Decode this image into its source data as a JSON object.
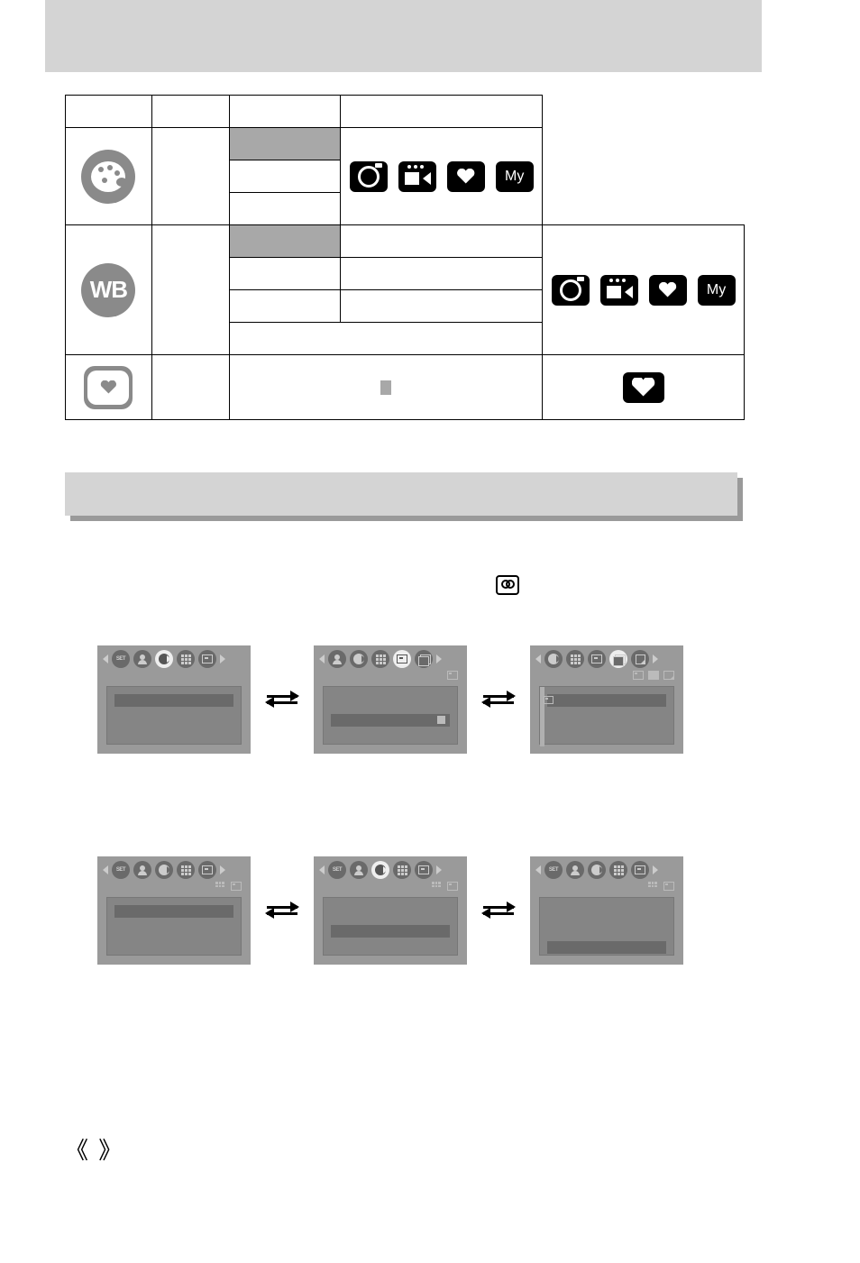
{
  "table": {
    "headers": [
      "",
      "",
      "",
      ""
    ],
    "rows": [
      {
        "icon": "palette",
        "col2": "",
        "col3": [
          "",
          "",
          ""
        ],
        "modes": [
          "camera",
          "video",
          "heart",
          "my"
        ]
      },
      {
        "icon": "wb",
        "col2": "",
        "col3_split": [
          [
            "",
            ""
          ],
          [
            "",
            ""
          ],
          [
            "",
            ""
          ]
        ],
        "col3_full": "",
        "modes": [
          "camera",
          "video",
          "heart",
          "my"
        ]
      },
      {
        "icon": "heart-frame",
        "col2": "",
        "col3_center_marker": "▮",
        "modes": [
          "heart"
        ]
      }
    ]
  },
  "icon_labels": {
    "palette": "palette-icon",
    "wb_text": "WB",
    "my_text": "My"
  },
  "section": {
    "title": ""
  },
  "inline_icon_line": "",
  "menu_screens": {
    "description": "Two rows of three camera-menu LCD mockups connected by bidirectional arrows",
    "tab_icons": [
      "set",
      "person",
      "left-arc",
      "grid",
      "frame",
      "stack",
      "corner"
    ],
    "row1": [
      {
        "active_tab_index": 2,
        "sub_icons": [],
        "bar_pos": "top",
        "bar_icon": null,
        "stripe": false,
        "tabs": [
          "set",
          "person",
          "left-arc",
          "grid",
          "frame"
        ]
      },
      {
        "active_tab_index": 3,
        "sub_icons": [
          "frame"
        ],
        "bar_pos": "mid",
        "bar_icon": "grid",
        "stripe": false,
        "tabs": [
          "person",
          "left-arc",
          "grid",
          "frame",
          "stack"
        ]
      },
      {
        "active_tab_index": 3,
        "sub_icons": [
          "frame",
          "sq",
          "corner"
        ],
        "bar_pos": "top",
        "bar_icon": "frame",
        "stripe": true,
        "tabs": [
          "left-arc",
          "grid",
          "frame",
          "stack",
          "corner"
        ]
      }
    ],
    "row2": [
      {
        "active_tab_index": null,
        "sub_icons": [
          "grid",
          "frame"
        ],
        "bar_pos": "top",
        "bar_icon": null,
        "stripe": false,
        "tabs": [
          "set",
          "person",
          "left-arc",
          "grid",
          "frame"
        ]
      },
      {
        "active_tab_index": 2,
        "sub_icons": [
          "grid",
          "frame"
        ],
        "bar_pos": "mid",
        "bar_icon": null,
        "stripe": false,
        "tabs": [
          "set",
          "person",
          "left-arc",
          "grid",
          "frame"
        ]
      },
      {
        "active_tab_index": null,
        "sub_icons": [
          "grid",
          "frame"
        ],
        "bar_pos": "bot",
        "bar_icon": null,
        "stripe": false,
        "tabs": [
          "set",
          "person",
          "left-arc",
          "grid",
          "frame"
        ]
      }
    ]
  },
  "page_marker": "《  》"
}
